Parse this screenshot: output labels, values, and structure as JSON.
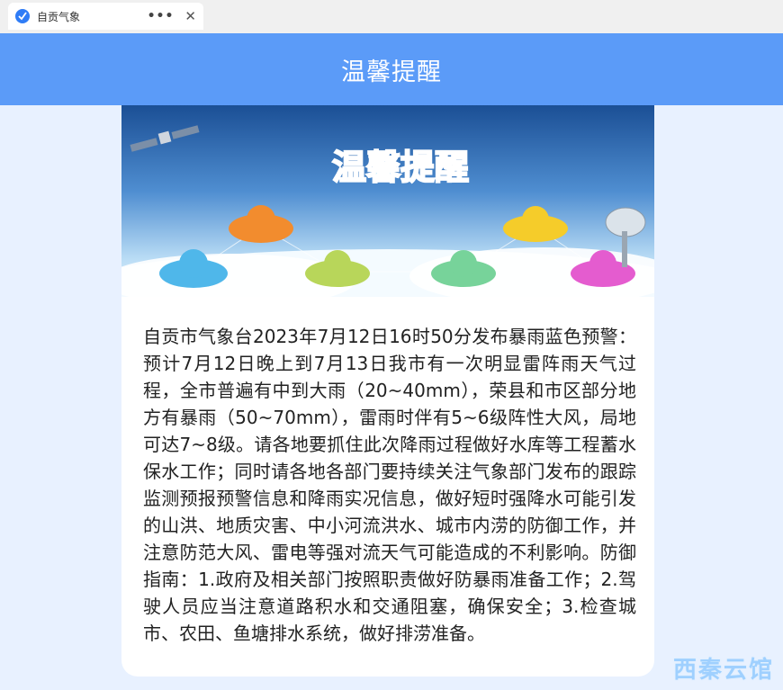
{
  "tab": {
    "title": "自贡气象",
    "more": "•••",
    "close": "✕"
  },
  "header": {
    "title": "温馨提醒"
  },
  "banner": {
    "title": "温馨提醒"
  },
  "notice": {
    "text": "自贡市气象台2023年7月12日16时50分发布暴雨蓝色预警：预计7月12日晚上到7月13日我市有一次明显雷阵雨天气过程，全市普遍有中到大雨（20~40mm），荣县和市区部分地方有暴雨（50~70mm），雷雨时伴有5~6级阵性大风，局地可达7~8级。请各地要抓住此次降雨过程做好水库等工程蓄水保水工作；同时请各地各部门要持续关注气象部门发布的跟踪监测预报预警信息和降雨实况信息，做好短时强降水可能引发的山洪、地质灾害、中小河流洪水、城市内涝的防御工作，并注意防范大风、雷电等强对流天气可能造成的不利影响。防御指南：1.政府及相关部门按照职责做好防暴雨准备工作；2.驾驶人员应当注意道路积水和交通阻塞，确保安全；3.检查城市、农田、鱼塘排水系统，做好排涝准备。"
  },
  "watermark": {
    "text": "西秦云馆"
  },
  "colors": {
    "header": "#5b9bf8",
    "background": "#e8f1ff",
    "tab_icon": "#2f7cf6"
  }
}
